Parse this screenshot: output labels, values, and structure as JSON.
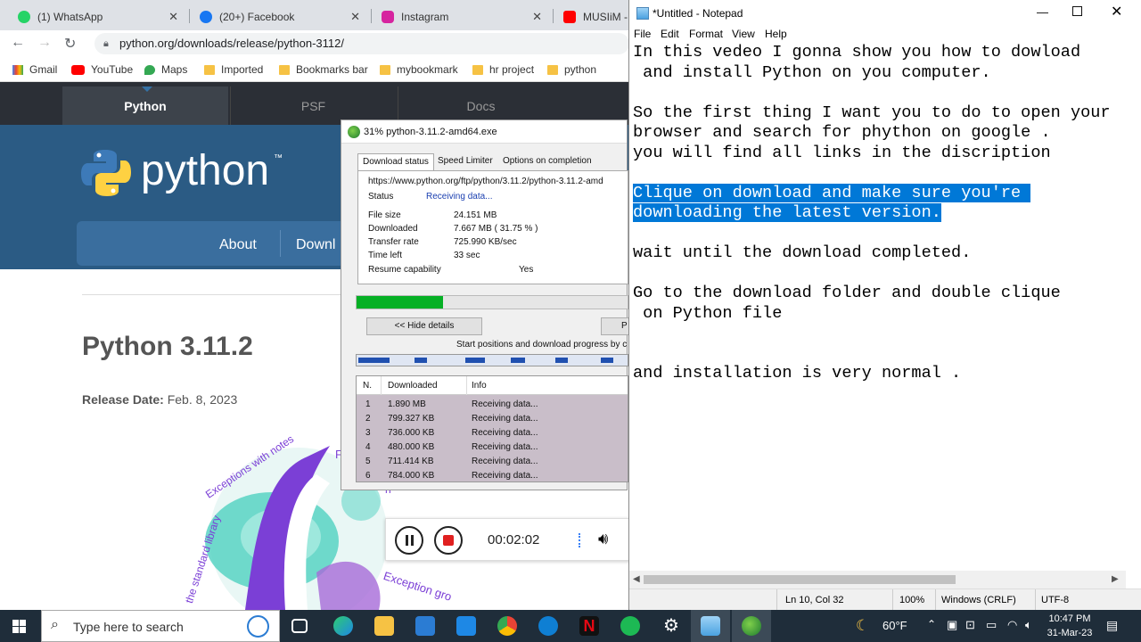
{
  "browser": {
    "tabs": [
      {
        "label": "(1) WhatsApp",
        "icon": "whatsapp-icon"
      },
      {
        "label": "(20+) Facebook",
        "icon": "facebook-icon"
      },
      {
        "label": "Instagram",
        "icon": "instagram-icon"
      },
      {
        "label": "MUSIiM -",
        "icon": "youtube-icon"
      }
    ],
    "url": "python.org/downloads/release/python-3112/",
    "bookmarks": [
      "Gmail",
      "YouTube",
      "Maps",
      "Imported",
      "Bookmarks bar",
      "mybookmark",
      "hr project",
      "python"
    ]
  },
  "python_site": {
    "nav": [
      "Python",
      "PSF",
      "Docs"
    ],
    "logo_text": "python",
    "tm": "™",
    "menu": [
      "About",
      "Downl"
    ],
    "heading": "Python 3.11.2",
    "release_label": "Release Date:",
    "release_value": "Feb. 8, 2023",
    "art_texts": [
      "Exceptions with notes",
      "the standard library",
      "Exception gro",
      "F",
      "n"
    ]
  },
  "idm": {
    "title": "31% python-3.11.2-amd64.exe",
    "tabs": [
      "Download status",
      "Speed Limiter",
      "Options on completion"
    ],
    "url": "https://www.python.org/ftp/python/3.11.2/python-3.11.2-amd",
    "status_label": "Status",
    "status_value": "Receiving data...",
    "fields": [
      {
        "label": "File size",
        "value": "24.151  MB"
      },
      {
        "label": "Downloaded",
        "value": "7.667  MB  ( 31.75 % )"
      },
      {
        "label": "Transfer rate",
        "value": "725.990  KB/sec"
      },
      {
        "label": "Time left",
        "value": "33 sec"
      },
      {
        "label": "Resume capability",
        "value": "Yes"
      }
    ],
    "progress": 0.3175,
    "hide_details": "<< Hide details",
    "pause_btn": "P",
    "start_positions": "Start positions and download progress by c",
    "table_headers": [
      "N.",
      "Downloaded",
      "Info"
    ],
    "table_rows": [
      [
        "1",
        "1.890  MB",
        "Receiving data..."
      ],
      [
        "2",
        "799.327  KB",
        "Receiving data..."
      ],
      [
        "3",
        "736.000  KB",
        "Receiving data..."
      ],
      [
        "4",
        "480.000  KB",
        "Receiving data..."
      ],
      [
        "5",
        "711.414  KB",
        "Receiving data..."
      ],
      [
        "6",
        "784.000  KB",
        "Receiving data..."
      ]
    ]
  },
  "recorder": {
    "time": "00:02:02"
  },
  "notepad": {
    "title": "*Untitled - Notepad",
    "menu": [
      "File",
      "Edit",
      "Format",
      "View",
      "Help"
    ],
    "lines_before": "In this vedeo I gonna show you how to dowload\n and install Python on you computer.\n\nSo the first thing I want you to do to open your\nbrowser and search for phython on google .\nyou will find all links in the discription\n\n",
    "selected": "Clique on download and make sure you're \ndownloading the latest version.",
    "lines_after": "\n\nwait until the download completed.\n\nGo to the download folder and double clique\n on Python file\n\n\nand installation is very normal .",
    "status": {
      "pos": "Ln 10, Col 32",
      "zoom": "100%",
      "eol": "Windows (CRLF)",
      "enc": "UTF-8"
    }
  },
  "taskbar": {
    "search_placeholder": "Type here to search",
    "temperature": "60°F",
    "time": "10:47 PM",
    "date": "31-Mar-23"
  }
}
